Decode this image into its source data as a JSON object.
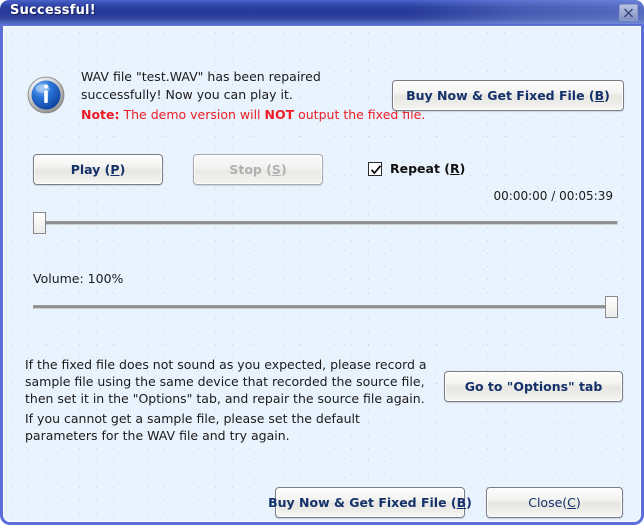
{
  "window": {
    "title": "Successful!",
    "close_icon": "close-icon",
    "border_color": "#5a6fd8",
    "titlebar_color": "#2b3f9e",
    "body_color": "#e9f3fd"
  },
  "header": {
    "icon": "info-icon",
    "message": "WAV file \"test.WAV\" has been repaired successfully! Now you can play it.",
    "note_prefix": "Note:",
    "note_mid1": " The demo version will ",
    "note_emphasis": "NOT",
    "note_mid2": " output the fixed file.",
    "note_color": "#ed1c24"
  },
  "buttons": {
    "buy_top": "Buy Now & Get Fixed File (B)",
    "buy_top_accel": "B",
    "play": "Play (P)",
    "play_accel": "P",
    "stop": "Stop (S)",
    "stop_accel": "S",
    "stop_enabled": "false",
    "options": "Go to \"Options\" tab",
    "buy_bottom": "Buy Now & Get Fixed File (B)",
    "buy_bottom_accel": "B",
    "close": "Close(C)",
    "close_accel": "C"
  },
  "repeat": {
    "label": "Repeat (R)",
    "accel": "R",
    "checked": "true"
  },
  "player": {
    "time_current": "00:00:00",
    "time_separator": " / ",
    "time_total": "00:05:39",
    "time_display": "00:00:00 / 00:05:39",
    "position_percent": 0,
    "volume_label": "Volume: 100%",
    "volume_percent": 100
  },
  "footer": {
    "paragraph1": "If the fixed file does not sound as you expected, please record a sample file using the same device that recorded the source file, then set it in the \"Options\" tab, and repair the source file again.",
    "paragraph2": "If you cannot get a sample file, please set the default parameters for the WAV file and try again."
  }
}
